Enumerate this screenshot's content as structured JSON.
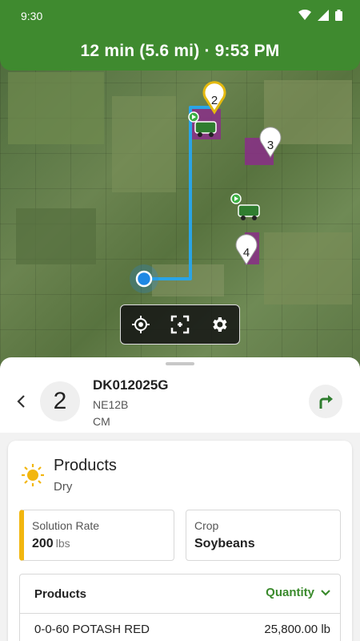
{
  "status": {
    "time": "9:30"
  },
  "header": {
    "eta": "12 min (5.6 mi) · 9:53 PM"
  },
  "map": {
    "markers": [
      {
        "label": "2",
        "style": "yellow"
      },
      {
        "label": "3",
        "style": "white"
      },
      {
        "label": "4",
        "style": "white"
      }
    ],
    "toolbar": {
      "locate_icon": "crosshair-icon",
      "fit_icon": "fit-bounds-icon",
      "settings_icon": "gear-icon"
    },
    "colors": {
      "route": "#2aa4e6",
      "field": "#8a2e88",
      "location": "#1e88e5"
    }
  },
  "stop": {
    "number": "2",
    "title": "DK012025G",
    "line1": "NE12B",
    "line2": "CM"
  },
  "product_card": {
    "title": "Products",
    "subtitle": "Dry",
    "icon": "sun-icon",
    "solution_rate": {
      "label": "Solution Rate",
      "value": "200",
      "unit": "lbs"
    },
    "crop": {
      "label": "Crop",
      "value": "Soybeans"
    },
    "table": {
      "col_products": "Products",
      "col_quantity": "Quantity",
      "rows": [
        {
          "name": "0-0-60 POTASH RED",
          "qty": "25,800.00 lb"
        }
      ]
    }
  },
  "theme": {
    "brand_green": "#3f8a2f",
    "accent_yellow": "#f2b60f"
  }
}
